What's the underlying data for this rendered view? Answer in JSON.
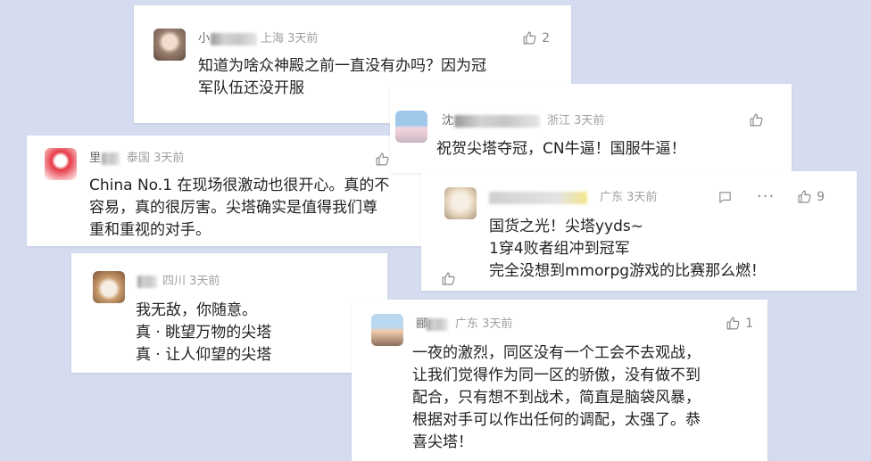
{
  "comments": [
    {
      "user_initial": "小",
      "meta": "上海 3天前",
      "likes": "2",
      "lines": [
        "知道为啥众神殿之前一直没有办吗？因为冠",
        "军队伍还没开服"
      ]
    },
    {
      "user_initial": "沈",
      "meta": "浙江 3天前",
      "likes": "",
      "lines": [
        "祝贺尖塔夺冠，CN牛逼！国服牛逼！"
      ]
    },
    {
      "user_initial": "里",
      "meta": "泰国 3天前",
      "likes": "",
      "lines": [
        "China No.1 在现场很激动也很开心。真的不",
        "容易，真的很厉害。尖塔确实是值得我们尊",
        "重和重视的对手。"
      ]
    },
    {
      "user_initial": "",
      "meta": "广东 3天前",
      "likes": "9",
      "lines": [
        "国货之光！尖塔yyds~",
        "1穿4败者组冲到冠军",
        "完全没想到mmorpg游戏的比赛那么燃！"
      ]
    },
    {
      "user_initial": "",
      "meta": "四川 3天前",
      "likes": "",
      "lines": [
        "我无敌，你随意。",
        "真 · 眺望万物的尖塔",
        "真 · 让人仰望的尖塔"
      ]
    },
    {
      "user_initial": "郦",
      "meta": "广东 3天前",
      "likes": "1",
      "lines": [
        "一夜的激烈，同区没有一个工会不去观战，",
        "让我们觉得作为同一区的骄傲，没有做不到",
        "配合，只有想不到战术，简直是脑袋风暴，",
        "根据对手可以作出任何的调配，太强了。恭",
        "喜尖塔！"
      ]
    }
  ],
  "icons": {
    "like": "thumb-up-icon",
    "reply": "comment-icon",
    "more": "more-icon",
    "more_glyph": "···"
  },
  "colors": {
    "background": "#d5dcef",
    "card": "#ffffff",
    "text": "#222222",
    "meta": "#a0a0a0"
  }
}
